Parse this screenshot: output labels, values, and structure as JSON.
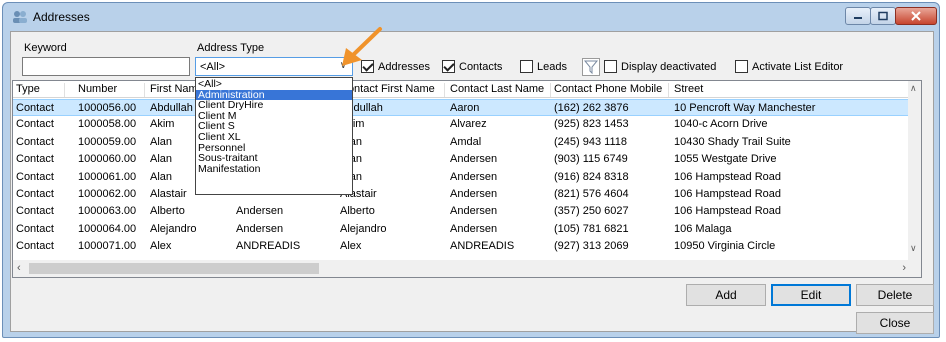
{
  "window": {
    "title": "Addresses"
  },
  "filters": {
    "keyword_label": "Keyword",
    "keyword_value": "",
    "address_type_label": "Address Type",
    "address_type_value": "<All>",
    "addresses_label": "Addresses",
    "addresses_checked": true,
    "contacts_label": "Contacts",
    "contacts_checked": true,
    "leads_label": "Leads",
    "leads_checked": false,
    "display_deactivated_label": "Display deactivated",
    "display_deactivated_checked": false,
    "activate_list_editor_label": "Activate List Editor",
    "activate_list_editor_checked": false
  },
  "dropdown": {
    "options": [
      "<All>",
      "Administration",
      "Client DryHire",
      "Client M",
      "Client S",
      "Client XL",
      "Personnel",
      "Sous-traitant",
      "Manifestation"
    ],
    "highlighted": "Administration"
  },
  "grid": {
    "columns": [
      "Type",
      "Number",
      "First Name",
      "",
      "Contact First Name",
      "Contact Last Name",
      "Contact Phone Mobile",
      "Street"
    ],
    "rows": [
      [
        "Contact",
        "1000056.00",
        "Abdullah",
        "",
        "Abdullah",
        "Aaron",
        "(162) 262 3876",
        "10 Pencroft Way Manchester"
      ],
      [
        "Contact",
        "1000058.00",
        "Akim",
        "",
        "Akim",
        "Alvarez",
        "(925) 823 1453",
        "1040-c Acorn Drive"
      ],
      [
        "Contact",
        "1000059.00",
        "Alan",
        "",
        "Alan",
        "Amdal",
        "(245) 943 1118",
        "10430 Shady Trail Suite"
      ],
      [
        "Contact",
        "1000060.00",
        "Alan",
        "",
        "Alan",
        "Andersen",
        "(903) 115 6749",
        "1055 Westgate Drive"
      ],
      [
        "Contact",
        "1000061.00",
        "Alan",
        "",
        "Alan",
        "Andersen",
        "(916) 824 8318",
        "106 Hampstead Road"
      ],
      [
        "Contact",
        "1000062.00",
        "Alastair",
        "",
        "Alastair",
        "Andersen",
        "(821) 576 4604",
        "106 Hampstead Road"
      ],
      [
        "Contact",
        "1000063.00",
        "Alberto",
        "Andersen",
        "Alberto",
        "Andersen",
        "(357) 250 6027",
        "106 Hampstead Road"
      ],
      [
        "Contact",
        "1000064.00",
        "Alejandro",
        "Andersen",
        "Alejandro",
        "Andersen",
        "(105) 781 6821",
        "106 Malaga"
      ],
      [
        "Contact",
        "1000071.00",
        "Alex",
        "ANDREADIS",
        "Alex",
        "ANDREADIS",
        "(927) 313 2069",
        "10950 Virginia Circle"
      ]
    ],
    "selected_row": 0
  },
  "buttons": {
    "add": "Add",
    "edit": "Edit",
    "delete": "Delete",
    "close": "Close"
  },
  "colors": {
    "accent": "#3875d7",
    "selection": "#cce8ff",
    "callout": "#f0932b"
  }
}
